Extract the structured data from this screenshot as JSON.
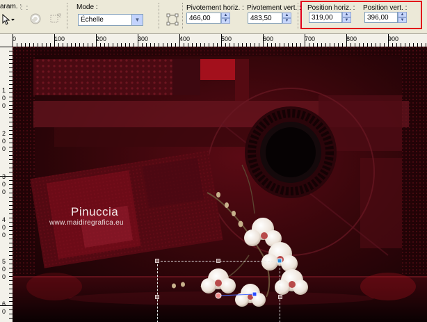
{
  "toolbar": {
    "params_label": "aram. :",
    "mode": {
      "label": "Mode :",
      "value": "Échelle"
    },
    "pivot_h": {
      "label": "Pivotement horiz. :",
      "value": "466,00"
    },
    "pivot_v": {
      "label": "Pivotement vert. :",
      "value": "483,50"
    },
    "pos_h": {
      "label": "Position horiz. :",
      "value": "319,00"
    },
    "pos_v": {
      "label": "Position vert. :",
      "value": "396,00"
    },
    "highlight_color": "#e2001a"
  },
  "ruler_top": {
    "labels": [
      "0",
      "100",
      "200",
      "300",
      "400",
      "500",
      "600",
      "700",
      "800",
      "900"
    ]
  },
  "ruler_left": {
    "labels": [
      "1",
      "0",
      "0",
      "2",
      "0",
      "0",
      "3",
      "0",
      "0",
      "4",
      "0",
      "0",
      "5",
      "0",
      "0",
      "6",
      "0"
    ]
  },
  "canvas": {
    "watermark_name": "Pinuccia",
    "watermark_url": "www.maidiregrafica.eu"
  }
}
